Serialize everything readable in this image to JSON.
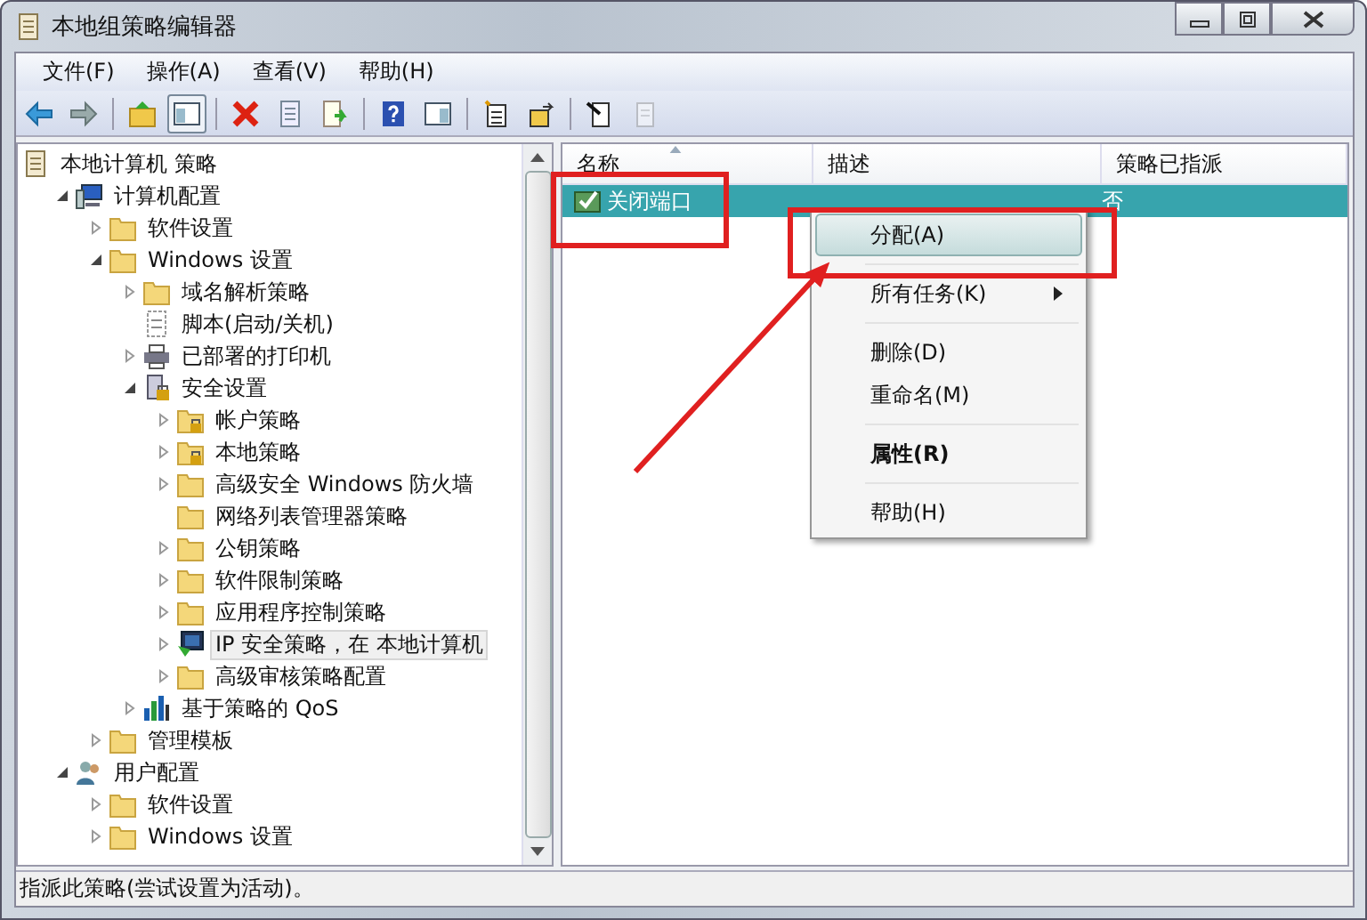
{
  "window": {
    "title": "本地组策略编辑器"
  },
  "menu_bar": [
    {
      "label": "文件(F)"
    },
    {
      "label": "操作(A)"
    },
    {
      "label": "查看(V)"
    },
    {
      "label": "帮助(H)"
    }
  ],
  "toolbar": [
    {
      "kind": "back"
    },
    {
      "kind": "forward"
    },
    {
      "kind": "sep"
    },
    {
      "kind": "up"
    },
    {
      "kind": "tree",
      "pressed": true
    },
    {
      "kind": "sep"
    },
    {
      "kind": "delete"
    },
    {
      "kind": "props"
    },
    {
      "kind": "export"
    },
    {
      "kind": "sep"
    },
    {
      "kind": "help"
    },
    {
      "kind": "pane"
    },
    {
      "kind": "sep"
    },
    {
      "kind": "newdoc"
    },
    {
      "kind": "assign"
    },
    {
      "kind": "sep"
    },
    {
      "kind": "switch"
    },
    {
      "kind": "unassign",
      "disabled": true
    }
  ],
  "tree": [
    {
      "label": "本地计算机 策略",
      "kind": "doc",
      "selected": false,
      "children": [
        {
          "label": "计算机配置",
          "kind": "computer",
          "expanded": true,
          "selected": false,
          "children": [
            {
              "label": "软件设置",
              "kind": "folder",
              "expanded": false,
              "selected": false
            },
            {
              "label": "Windows 设置",
              "kind": "folder",
              "expanded": true,
              "selected": false,
              "children": [
                {
                  "label": "域名解析策略",
                  "kind": "folder",
                  "expanded": false,
                  "selected": false
                },
                {
                  "label": "脚本(启动/关机)",
                  "kind": "script",
                  "selected": false
                },
                {
                  "label": "已部署的打印机",
                  "kind": "printer",
                  "expanded": false,
                  "selected": false
                },
                {
                  "label": "安全设置",
                  "kind": "security",
                  "expanded": true,
                  "selected": false,
                  "children": [
                    {
                      "label": "帐户策略",
                      "kind": "folderlock",
                      "expanded": false,
                      "selected": false
                    },
                    {
                      "label": "本地策略",
                      "kind": "folderlock",
                      "expanded": false,
                      "selected": false
                    },
                    {
                      "label": "高级安全 Windows 防火墙",
                      "kind": "folder",
                      "expanded": false,
                      "selected": false
                    },
                    {
                      "label": "网络列表管理器策略",
                      "kind": "folder",
                      "selected": false
                    },
                    {
                      "label": "公钥策略",
                      "kind": "folder",
                      "expanded": false,
                      "selected": false
                    },
                    {
                      "label": "软件限制策略",
                      "kind": "folder",
                      "expanded": false,
                      "selected": false
                    },
                    {
                      "label": "应用程序控制策略",
                      "kind": "folder",
                      "expanded": false,
                      "selected": false
                    },
                    {
                      "label": "IP 安全策略，在 本地计算机",
                      "kind": "ipsec",
                      "expanded": false,
                      "selected": true
                    },
                    {
                      "label": "高级审核策略配置",
                      "kind": "folder",
                      "expanded": false,
                      "selected": false
                    }
                  ]
                },
                {
                  "label": "基于策略的 QoS",
                  "kind": "qos",
                  "expanded": false,
                  "selected": false
                }
              ]
            },
            {
              "label": "管理模板",
              "kind": "folder",
              "expanded": false,
              "selected": false
            }
          ]
        },
        {
          "label": "用户配置",
          "kind": "user",
          "expanded": true,
          "selected": false,
          "children": [
            {
              "label": "软件设置",
              "kind": "folder",
              "expanded": false,
              "selected": false
            },
            {
              "label": "Windows 设置",
              "kind": "folder",
              "expanded": false,
              "selected": false
            }
          ]
        }
      ]
    }
  ],
  "table": {
    "columns": [
      {
        "label": "名称",
        "sorted": true
      },
      {
        "label": "描述",
        "sorted": false
      },
      {
        "label": "策略已指派",
        "sorted": false
      }
    ],
    "rows": [
      {
        "name": "关闭端口",
        "assigned": "否",
        "selected": true
      }
    ]
  },
  "context_menu": {
    "groups": [
      [
        {
          "label": "分配(A)",
          "selected": true,
          "bold": false,
          "submenu": false
        }
      ],
      [
        {
          "label": "所有任务(K)",
          "selected": false,
          "bold": false,
          "submenu": true
        }
      ],
      [
        {
          "label": "删除(D)",
          "selected": false,
          "bold": false,
          "submenu": false
        },
        {
          "label": "重命名(M)",
          "selected": false,
          "bold": false,
          "submenu": false
        }
      ],
      [
        {
          "label": "属性(R)",
          "selected": false,
          "bold": true,
          "submenu": false
        }
      ],
      [
        {
          "label": "帮助(H)",
          "selected": false,
          "bold": false,
          "submenu": false
        }
      ]
    ]
  },
  "status_bar": "指派此策略(尝试设置为活动)。"
}
